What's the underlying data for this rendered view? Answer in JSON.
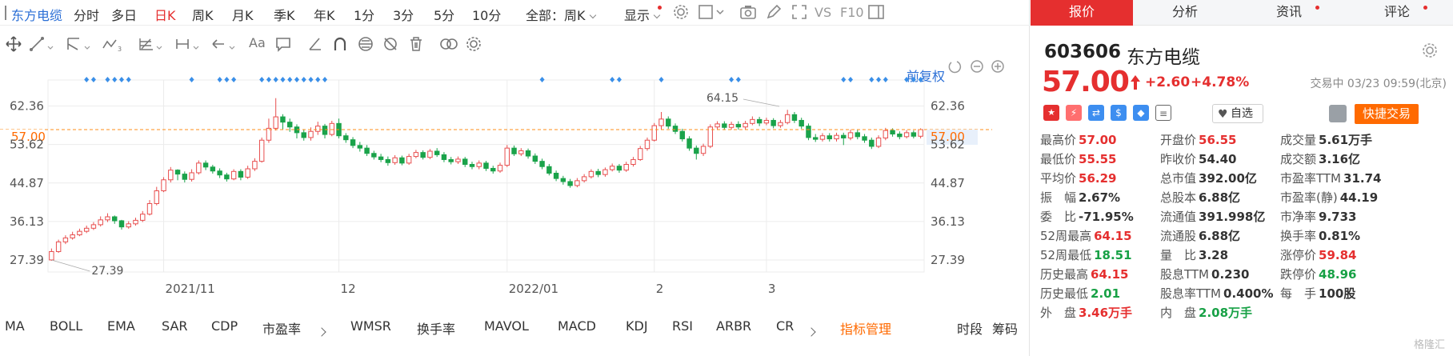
{
  "toolbar": {
    "stock_name": "东方电缆",
    "periods": [
      "分时",
      "多日",
      "日K",
      "周K",
      "月K",
      "季K",
      "年K",
      "1分",
      "3分",
      "5分",
      "10分"
    ],
    "active_period": "日K",
    "range_select": "全部：周K",
    "display_label": "显示",
    "vs_label": "VS",
    "f10_label": "F10"
  },
  "chart": {
    "restore_label": "前复权",
    "y_ticks": [
      "62.36",
      "53.62",
      "44.87",
      "36.13",
      "27.39"
    ],
    "current_price_label": "57.00",
    "x_labels": [
      "2021/11",
      "12",
      "2022/01",
      "2",
      "3"
    ],
    "high_annotation": "64.15",
    "low_annotation": "27.39",
    "colors": {
      "up": "#e84e4e",
      "down": "#1aa34a",
      "price_line": "#ff8c1a",
      "marker": "#3a8fe8",
      "grid": "#ececec"
    }
  },
  "chart_data": {
    "type": "candlestick",
    "ylim": [
      24.66,
      68.27
    ],
    "high": 64.15,
    "low": 27.39,
    "last": 57.0,
    "candles": [
      [
        27.4,
        29.3,
        30.0,
        27.2
      ],
      [
        29.3,
        31.5,
        32.0,
        29.0
      ],
      [
        31.5,
        32.4,
        33.0,
        31.0
      ],
      [
        32.4,
        33.1,
        33.8,
        32.0
      ],
      [
        33.1,
        33.9,
        34.5,
        32.8
      ],
      [
        33.9,
        34.6,
        35.2,
        33.5
      ],
      [
        34.6,
        35.4,
        36.0,
        34.2
      ],
      [
        35.4,
        36.5,
        37.3,
        35.0
      ],
      [
        36.5,
        37.2,
        38.0,
        36.0
      ],
      [
        37.2,
        36.3,
        37.5,
        35.6
      ],
      [
        36.3,
        34.9,
        36.5,
        34.3
      ],
      [
        34.9,
        35.6,
        36.2,
        34.5
      ],
      [
        35.6,
        36.4,
        37.0,
        35.2
      ],
      [
        36.4,
        37.8,
        38.5,
        36.0
      ],
      [
        37.8,
        40.2,
        41.0,
        37.5
      ],
      [
        40.2,
        43.1,
        44.0,
        39.8
      ],
      [
        43.1,
        45.6,
        46.2,
        42.8
      ],
      [
        45.6,
        47.8,
        48.5,
        45.0
      ],
      [
        47.8,
        46.9,
        48.0,
        45.5
      ],
      [
        46.9,
        45.7,
        47.5,
        45.0
      ],
      [
        45.7,
        47.2,
        48.0,
        45.2
      ],
      [
        47.2,
        49.4,
        50.0,
        46.8
      ],
      [
        49.4,
        48.5,
        50.0,
        47.8
      ],
      [
        48.5,
        47.6,
        49.0,
        47.0
      ],
      [
        47.6,
        46.7,
        48.2,
        46.0
      ],
      [
        46.7,
        45.8,
        47.2,
        45.2
      ],
      [
        45.8,
        47.5,
        48.0,
        45.5
      ],
      [
        47.5,
        46.2,
        48.0,
        45.5
      ],
      [
        46.2,
        48.1,
        48.8,
        45.8
      ],
      [
        48.1,
        49.8,
        50.5,
        47.6
      ],
      [
        49.8,
        54.6,
        55.2,
        49.5
      ],
      [
        54.6,
        57.3,
        59.5,
        54.0
      ],
      [
        57.3,
        59.9,
        64.15,
        56.8
      ],
      [
        59.9,
        58.7,
        60.5,
        57.0
      ],
      [
        58.7,
        57.6,
        59.5,
        56.5
      ],
      [
        57.6,
        56.3,
        58.2,
        55.0
      ],
      [
        56.3,
        55.2,
        57.0,
        54.5
      ],
      [
        55.2,
        56.6,
        57.5,
        54.5
      ],
      [
        56.6,
        57.8,
        58.8,
        55.8
      ],
      [
        57.8,
        55.9,
        58.3,
        55.0
      ],
      [
        55.9,
        58.4,
        59.0,
        55.5
      ],
      [
        58.4,
        55.6,
        59.5,
        55.0
      ],
      [
        55.6,
        54.7,
        56.2,
        54.0
      ],
      [
        54.7,
        53.4,
        55.3,
        52.8
      ],
      [
        53.4,
        52.8,
        54.2,
        52.0
      ],
      [
        52.8,
        51.6,
        53.5,
        51.0
      ],
      [
        51.6,
        50.8,
        52.2,
        50.2
      ],
      [
        50.8,
        50.2,
        51.5,
        49.6
      ],
      [
        50.2,
        49.5,
        50.9,
        48.8
      ],
      [
        49.5,
        50.6,
        51.2,
        49.0
      ],
      [
        50.6,
        49.4,
        51.1,
        48.9
      ],
      [
        49.4,
        50.9,
        51.5,
        49.0
      ],
      [
        50.9,
        51.8,
        52.4,
        50.5
      ],
      [
        51.8,
        50.7,
        52.3,
        50.2
      ],
      [
        50.7,
        52.1,
        52.6,
        50.3
      ],
      [
        52.1,
        51.3,
        52.8,
        50.8
      ],
      [
        51.3,
        50.2,
        51.9,
        49.6
      ],
      [
        50.2,
        49.7,
        50.8,
        49.1
      ],
      [
        49.7,
        50.3,
        50.9,
        49.2
      ],
      [
        50.3,
        49.1,
        50.8,
        48.5
      ],
      [
        49.1,
        48.6,
        49.7,
        48.0
      ],
      [
        48.6,
        49.4,
        50.0,
        48.0
      ],
      [
        49.4,
        48.2,
        49.9,
        47.6
      ],
      [
        48.2,
        47.6,
        48.8,
        47.0
      ],
      [
        47.6,
        48.9,
        49.5,
        47.2
      ],
      [
        48.9,
        52.8,
        53.5,
        48.5
      ],
      [
        52.8,
        51.5,
        53.4,
        51.0
      ],
      [
        51.5,
        52.2,
        52.8,
        51.0
      ],
      [
        52.2,
        51.0,
        52.7,
        50.4
      ],
      [
        51.0,
        49.8,
        51.6,
        49.2
      ],
      [
        49.8,
        48.6,
        50.4,
        48.0
      ],
      [
        48.6,
        47.1,
        49.2,
        46.6
      ],
      [
        47.1,
        45.9,
        47.7,
        45.3
      ],
      [
        45.9,
        45.2,
        46.5,
        44.5
      ],
      [
        45.2,
        44.3,
        45.8,
        43.8
      ],
      [
        44.3,
        45.4,
        46.0,
        43.9
      ],
      [
        45.4,
        46.3,
        46.9,
        45.0
      ],
      [
        46.3,
        47.5,
        48.0,
        45.9
      ],
      [
        47.5,
        46.8,
        48.1,
        46.2
      ],
      [
        46.8,
        47.9,
        48.4,
        46.3
      ],
      [
        47.9,
        48.7,
        49.3,
        47.5
      ],
      [
        48.7,
        47.8,
        49.2,
        47.2
      ],
      [
        47.8,
        49.1,
        49.7,
        47.4
      ],
      [
        49.1,
        50.2,
        50.8,
        48.6
      ],
      [
        50.2,
        52.7,
        53.3,
        49.9
      ],
      [
        52.7,
        54.6,
        55.2,
        52.2
      ],
      [
        54.6,
        57.9,
        58.5,
        54.3
      ],
      [
        57.9,
        59.4,
        61.0,
        57.0
      ],
      [
        59.4,
        57.8,
        60.0,
        57.2
      ],
      [
        57.8,
        56.6,
        58.4,
        56.0
      ],
      [
        56.6,
        54.9,
        57.2,
        54.3
      ],
      [
        54.9,
        52.8,
        55.5,
        52.2
      ],
      [
        52.8,
        51.6,
        53.4,
        50.2
      ],
      [
        51.6,
        53.2,
        53.8,
        51.0
      ],
      [
        53.2,
        57.6,
        58.2,
        52.8
      ],
      [
        57.6,
        58.3,
        58.9,
        57.0
      ],
      [
        58.3,
        57.5,
        58.9,
        56.9
      ],
      [
        57.5,
        58.2,
        58.8,
        57.0
      ],
      [
        58.2,
        57.6,
        58.9,
        57.0
      ],
      [
        57.6,
        58.4,
        59.0,
        57.0
      ],
      [
        58.4,
        59.3,
        60.0,
        58.0
      ],
      [
        59.3,
        58.5,
        59.9,
        57.8
      ],
      [
        58.5,
        59.1,
        59.7,
        58.0
      ],
      [
        59.1,
        57.9,
        59.6,
        57.3
      ],
      [
        57.9,
        58.6,
        59.2,
        57.4
      ],
      [
        58.6,
        60.4,
        61.5,
        58.2
      ],
      [
        60.4,
        59.1,
        61.0,
        58.5
      ],
      [
        59.1,
        57.8,
        59.7,
        57.2
      ],
      [
        57.8,
        55.2,
        58.4,
        54.6
      ],
      [
        55.2,
        54.8,
        56.0,
        54.2
      ],
      [
        54.8,
        55.6,
        56.2,
        54.3
      ],
      [
        55.6,
        54.9,
        56.2,
        54.3
      ],
      [
        54.9,
        55.7,
        56.3,
        54.3
      ],
      [
        55.7,
        55.1,
        56.3,
        53.5
      ],
      [
        55.1,
        56.3,
        57.0,
        54.6
      ],
      [
        56.3,
        55.4,
        56.9,
        54.8
      ],
      [
        55.4,
        54.6,
        56.0,
        54.0
      ],
      [
        54.6,
        53.2,
        55.2,
        52.6
      ],
      [
        53.2,
        55.1,
        55.7,
        52.8
      ],
      [
        55.1,
        56.8,
        57.4,
        54.6
      ],
      [
        56.8,
        56.0,
        57.3,
        55.4
      ],
      [
        56.0,
        55.4,
        56.6,
        54.8
      ],
      [
        55.4,
        56.3,
        56.9,
        55.0
      ],
      [
        56.3,
        55.5,
        56.8,
        55.0
      ],
      [
        55.5,
        57.0,
        57.3,
        55.0
      ]
    ],
    "marker_positions": [
      5,
      6,
      8,
      9,
      10,
      11,
      20,
      24,
      25,
      26,
      30,
      31,
      32,
      33,
      34,
      35,
      36,
      37,
      38,
      39,
      70,
      80,
      81,
      87,
      97,
      98,
      113,
      114,
      117,
      118,
      119,
      122,
      123,
      124
    ]
  },
  "indicators": [
    "MA",
    "BOLL",
    "EMA",
    "SAR",
    "CDP",
    "市盈率",
    "WMSR",
    "换手率",
    "MAVOL",
    "MACD",
    "KDJ",
    "RSI",
    "ARBR",
    "CR"
  ],
  "indicator_manage": "指标管理",
  "footer_tabs": [
    "时段",
    "筹码"
  ],
  "panel": {
    "tabs": [
      "报价",
      "分析",
      "资讯",
      "评论"
    ],
    "active_tab": "报价",
    "code": "603606",
    "name": "东方电缆",
    "price": "57.00",
    "change": "+2.60",
    "change_pct": "+4.78%",
    "status": "交易中 03/23 09:59(北京)",
    "zixuan_label": "自选",
    "quick_trade_label": "快捷交易",
    "watermark": "格隆汇"
  },
  "stats": [
    {
      "label": "最高价",
      "value": "57.00",
      "color": "red"
    },
    {
      "label": "开盘价",
      "value": "56.55",
      "color": "red"
    },
    {
      "label": "成交量",
      "value": "5.61万手",
      "color": "normal"
    },
    {
      "label": "最低价",
      "value": "55.55",
      "color": "red"
    },
    {
      "label": "昨收价",
      "value": "54.40",
      "color": "normal"
    },
    {
      "label": "成交额",
      "value": "3.16亿",
      "color": "normal"
    },
    {
      "label": "平均价",
      "value": "56.29",
      "color": "red"
    },
    {
      "label": "总市值",
      "value": "392.00亿",
      "color": "normal"
    },
    {
      "label": "市盈率TTM",
      "value": "31.74",
      "color": "normal"
    },
    {
      "label": "振　幅",
      "value": "2.67%",
      "color": "normal"
    },
    {
      "label": "总股本",
      "value": "6.88亿",
      "color": "normal"
    },
    {
      "label": "市盈率(静)",
      "value": "44.19",
      "color": "normal"
    },
    {
      "label": "委　比",
      "value": "-71.95%",
      "color": "normal"
    },
    {
      "label": "流通值",
      "value": "391.998亿",
      "color": "normal"
    },
    {
      "label": "市净率",
      "value": "9.733",
      "color": "normal"
    },
    {
      "label": "52周最高",
      "value": "64.15",
      "color": "red"
    },
    {
      "label": "流通股",
      "value": "6.88亿",
      "color": "normal"
    },
    {
      "label": "换手率",
      "value": "0.81%",
      "color": "normal"
    },
    {
      "label": "52周最低",
      "value": "18.51",
      "color": "green"
    },
    {
      "label": "量　比",
      "value": "3.28",
      "color": "normal"
    },
    {
      "label": "涨停价",
      "value": "59.84",
      "color": "red"
    },
    {
      "label": "历史最高",
      "value": "64.15",
      "color": "red"
    },
    {
      "label": "股息TTM",
      "value": "0.230",
      "color": "normal"
    },
    {
      "label": "跌停价",
      "value": "48.96",
      "color": "green"
    },
    {
      "label": "历史最低",
      "value": "2.01",
      "color": "green"
    },
    {
      "label": "股息率TTM",
      "value": "0.400%",
      "color": "normal"
    },
    {
      "label": "每　手",
      "value": "100股",
      "color": "normal"
    },
    {
      "label": "外　盘",
      "value": "3.46万手",
      "color": "red"
    },
    {
      "label": "内　盘",
      "value": "2.08万手",
      "color": "green"
    }
  ]
}
